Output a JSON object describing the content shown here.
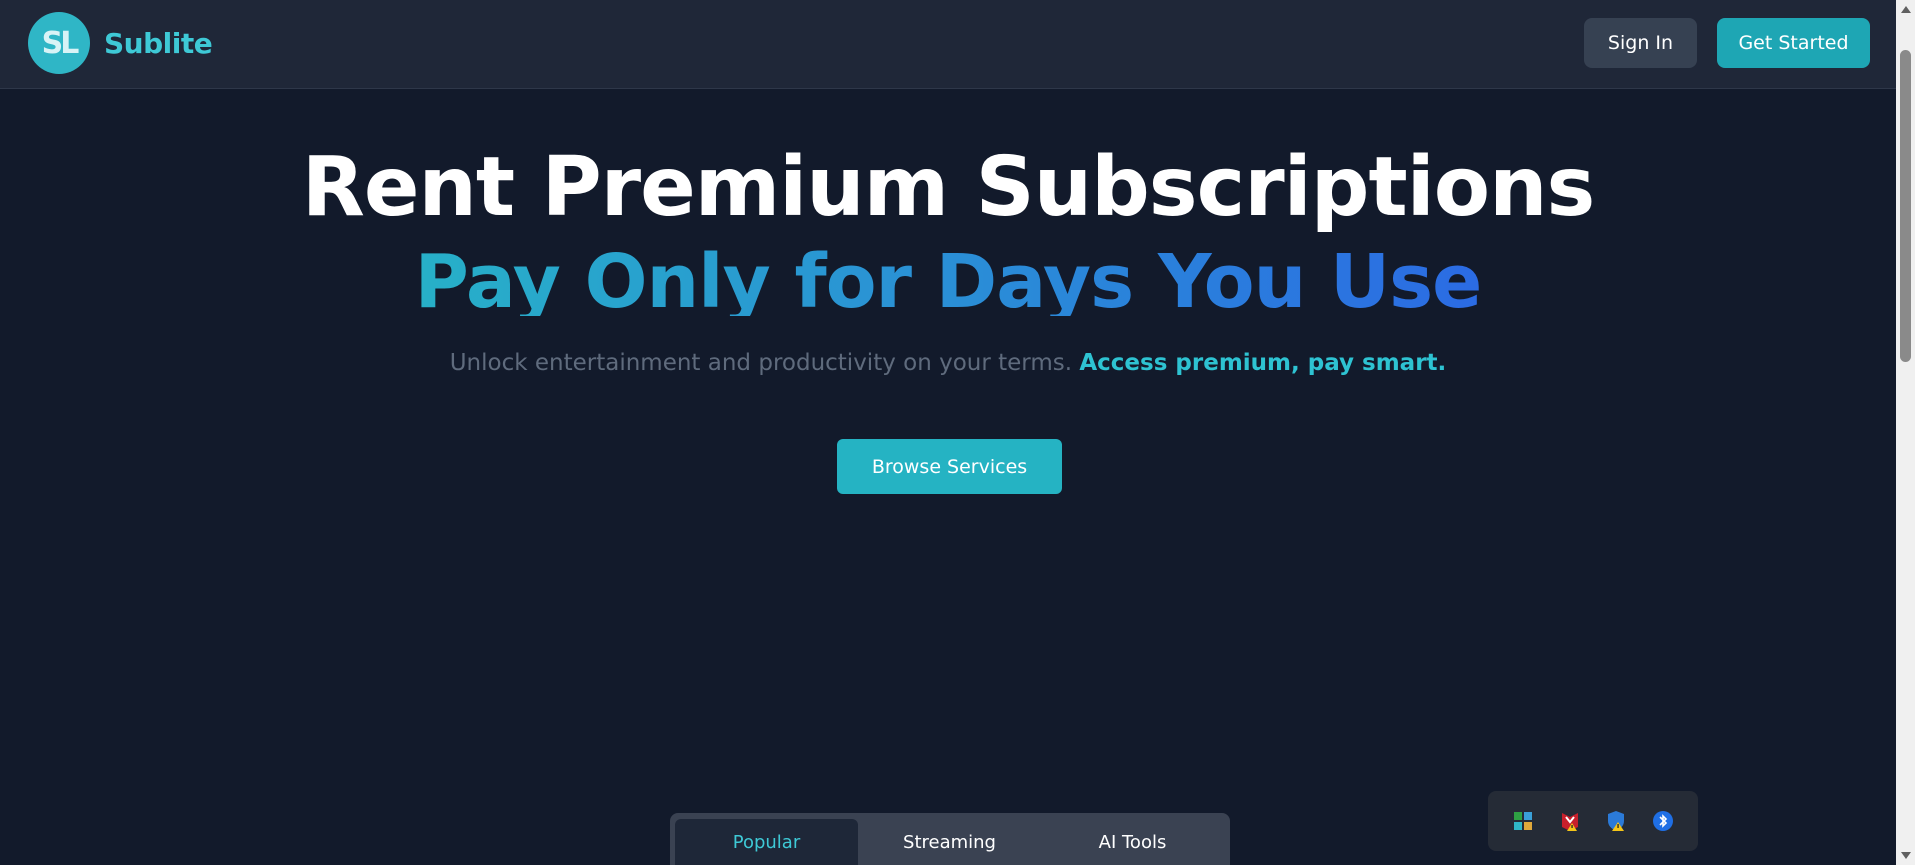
{
  "header": {
    "logo_text": "SL",
    "brand_name": "Sublite",
    "sign_in_label": "Sign In",
    "get_started_label": "Get Started"
  },
  "hero": {
    "title": "Rent Premium Subscriptions",
    "subtitle": "Pay Only for Days You Use",
    "tagline_muted": "Unlock entertainment and productivity on your terms.",
    "tagline_accent": "Access premium, pay smart.",
    "browse_label": "Browse Services"
  },
  "tabs": [
    {
      "label": "Popular",
      "active": true
    },
    {
      "label": "Streaming",
      "active": false
    },
    {
      "label": "AI Tools",
      "active": false
    }
  ],
  "tray": {
    "icons": [
      "app-grid-icon",
      "mcafee-warning-icon",
      "defender-warning-icon",
      "bluetooth-icon"
    ]
  },
  "colors": {
    "background": "#121a2b",
    "header": "#1f2738",
    "accent": "#25b3c3",
    "brand": "#3ec9d6",
    "gradient_start": "#27b0c8",
    "gradient_end": "#2b6be4"
  }
}
